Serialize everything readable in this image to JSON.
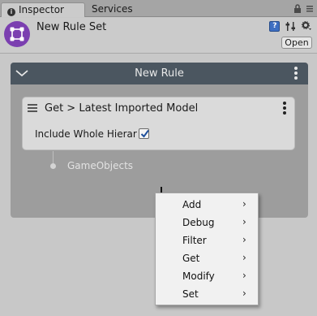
{
  "tabs": [
    {
      "label": "Inspector",
      "active": true,
      "icon": "info-icon"
    },
    {
      "label": "Services",
      "active": false
    }
  ],
  "tabbar_icons": [
    "lock-icon",
    "menu-icon"
  ],
  "header": {
    "title": "New Rule Set",
    "open_button": "Open",
    "asset_icon": "rule-set-icon",
    "icons": [
      "help-icon",
      "presets-icon",
      "settings-icon"
    ],
    "accent": "#7b3fb0"
  },
  "rule": {
    "title": "New Rule",
    "header_color": "#4b5660",
    "operation": {
      "title": "Get > Latest Imported Model",
      "option_label": "Include Whole Hierarchy",
      "option_checked": true
    },
    "output_port": "GameObjects"
  },
  "context_menu": {
    "items": [
      {
        "label": "Add",
        "arrow": "›"
      },
      {
        "label": "Debug",
        "arrow": "›"
      },
      {
        "label": "Filter",
        "arrow": "›"
      },
      {
        "label": "Get",
        "arrow": "›"
      },
      {
        "label": "Modify",
        "arrow": "›"
      },
      {
        "label": "Set",
        "arrow": "›"
      }
    ]
  }
}
